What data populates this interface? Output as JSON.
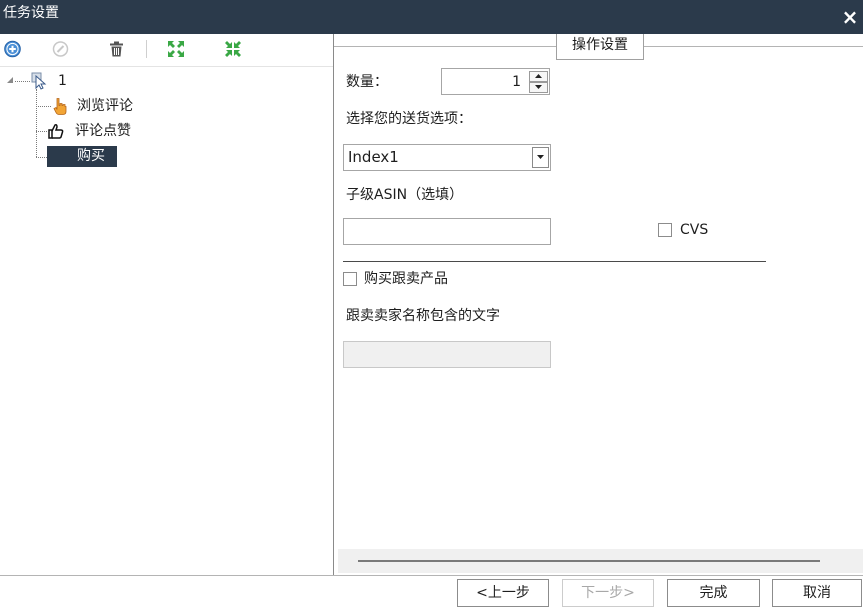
{
  "window": {
    "title": "任务设置",
    "close": "×"
  },
  "toolbar": {
    "icons": [
      "add-icon",
      "disabled-icon",
      "trash-icon",
      "expand-icon",
      "collapse-icon"
    ]
  },
  "tree": {
    "root": {
      "label": "1",
      "icon": "cursor-icon"
    },
    "children": [
      {
        "label": "浏览评论",
        "icon": "hand-pointer-icon"
      },
      {
        "label": "评论点赞",
        "icon": "thumbs-up-icon"
      },
      {
        "label": "购买",
        "selected": true
      }
    ]
  },
  "settings": {
    "group_title": "操作设置",
    "quantity": {
      "label": "数量：",
      "value": "1"
    },
    "shipping": {
      "label": "选择您的送货选项：",
      "value": "Index1"
    },
    "child_asin": {
      "label": "子级ASIN（选填）",
      "value": ""
    },
    "cvs": {
      "label": "CVS",
      "checked": false
    },
    "buy_follow": {
      "label": "购买跟卖产品",
      "checked": false
    },
    "seller_name": {
      "label": "跟卖卖家名称包含的文字",
      "value": "",
      "disabled": true
    }
  },
  "footer": {
    "prev": {
      "label": "<上一步",
      "enabled": true
    },
    "next": {
      "label": "下一步>",
      "enabled": false
    },
    "finish": {
      "label": "完成",
      "enabled": true
    },
    "cancel": {
      "label": "取消",
      "enabled": true
    }
  },
  "colors": {
    "titlebar": "#2b3a4b",
    "selection": "#2b3a4b",
    "icon_green": "#3aa845",
    "icon_blue": "#4a8fd6"
  }
}
